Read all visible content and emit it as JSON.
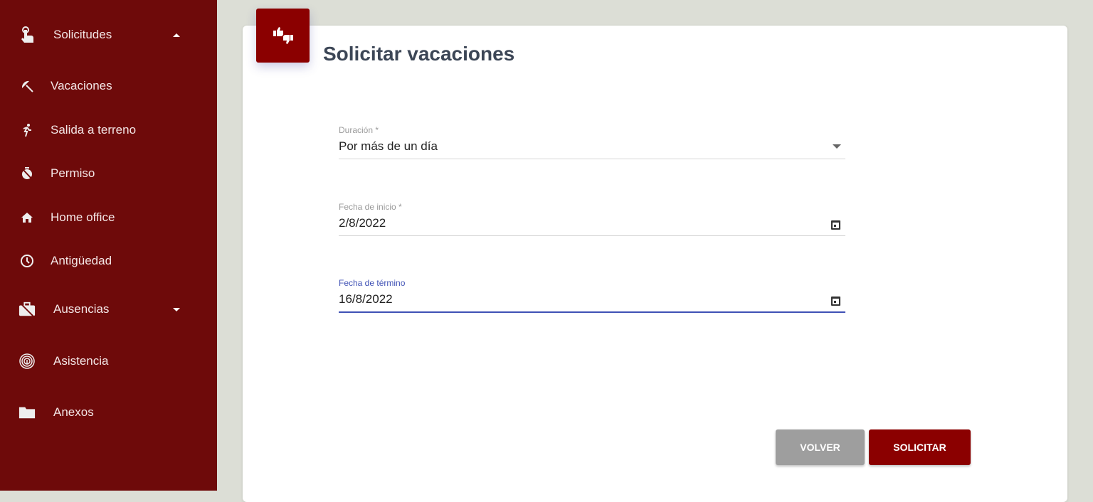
{
  "sidebar": {
    "items": [
      {
        "label": "Solicitudes",
        "icon": "touch-icon",
        "expanded": true
      },
      {
        "label": "Vacaciones",
        "icon": "beach-umbrella-icon"
      },
      {
        "label": "Salida a terreno",
        "icon": "running-icon"
      },
      {
        "label": "Permiso",
        "icon": "timer-off-icon"
      },
      {
        "label": "Home office",
        "icon": "home-icon"
      },
      {
        "label": "Antigüedad",
        "icon": "clock-icon"
      },
      {
        "label": "Ausencias",
        "icon": "work-off-icon",
        "expanded": false
      },
      {
        "label": "Asistencia",
        "icon": "fingerprint-icon"
      },
      {
        "label": "Anexos",
        "icon": "folder-icon"
      }
    ]
  },
  "header": {
    "title": "Solicitar vacaciones",
    "icon": "thumbs-up-down-icon"
  },
  "form": {
    "duracion": {
      "label": "Duración *",
      "value": "Por más de un día"
    },
    "inicio": {
      "label": "Fecha de inicio *",
      "value": "2/8/2022"
    },
    "termino": {
      "label": "Fecha de término",
      "value": "16/8/2022"
    }
  },
  "buttons": {
    "back": "VOLVER",
    "submit": "SOLICITAR"
  },
  "colors": {
    "sidebar": "#6e0a0a",
    "accent": "#8b0000",
    "focus": "#3f51b5"
  }
}
